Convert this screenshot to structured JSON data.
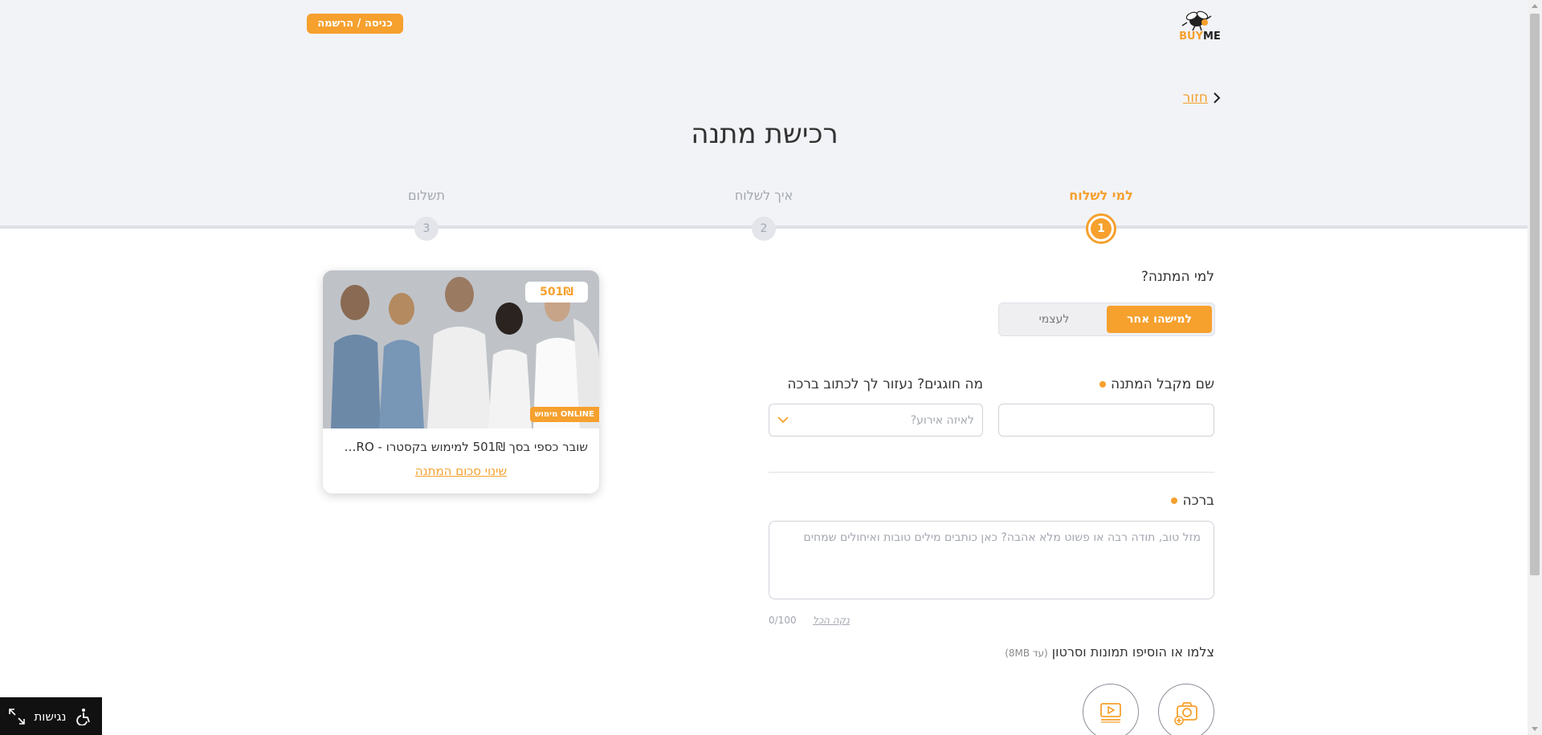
{
  "header": {
    "login_label": "כניסה / הרשמה",
    "logo_buy": "BUY",
    "logo_me": "ME"
  },
  "nav": {
    "back_label": "חזור"
  },
  "page": {
    "title": "רכישת מתנה"
  },
  "steps": [
    {
      "label": "למי לשלוח",
      "number": "1",
      "active": true
    },
    {
      "label": "איך לשלוח",
      "number": "2",
      "active": false
    },
    {
      "label": "תשלום",
      "number": "3",
      "active": false
    }
  ],
  "recipient": {
    "question": "למי המתנה?",
    "options": {
      "someone_else": "למישהו אחר",
      "myself": "לעצמי"
    },
    "selected": "someone_else"
  },
  "form": {
    "recipient_name_label": "שם מקבל המתנה",
    "recipient_name_value": "",
    "occasion_label": "מה חוגגים? נעזור לך לכתוב ברכה",
    "occasion_placeholder": "לאיזה אירוע?",
    "blessing_label": "ברכה",
    "blessing_placeholder": "מזל טוב, תודה רבה או פשוט מלא אהבה? כאן כותבים מילים טובות ואיחולים שמחים",
    "blessing_value": "",
    "counter": "0/100",
    "clear_all": "נקה הכל",
    "media_label": "צלמו או הוסיפו תמונות וסרטון",
    "media_note": "(עד 8MB)"
  },
  "card": {
    "price": "501₪",
    "online_badge": "מימוש ONLINE",
    "description": "שובר כספי בסך 501₪ למימוש בקסטרו - STRO...",
    "change_amount": "שינוי סכום המתנה"
  },
  "accessibility": {
    "label": "נגישות"
  },
  "colors": {
    "accent": "#f6a02d",
    "background_top": "#f2f3f7",
    "text": "#333333",
    "muted": "#a3a7b0"
  },
  "icons": {
    "back": "chevron-right-icon",
    "occasion_dropdown": "chevron-down-icon",
    "camera": "camera-plus-icon",
    "video": "video-play-icon",
    "accessibility": "wheelchair-icon",
    "expand": "expand-arrows-icon"
  }
}
